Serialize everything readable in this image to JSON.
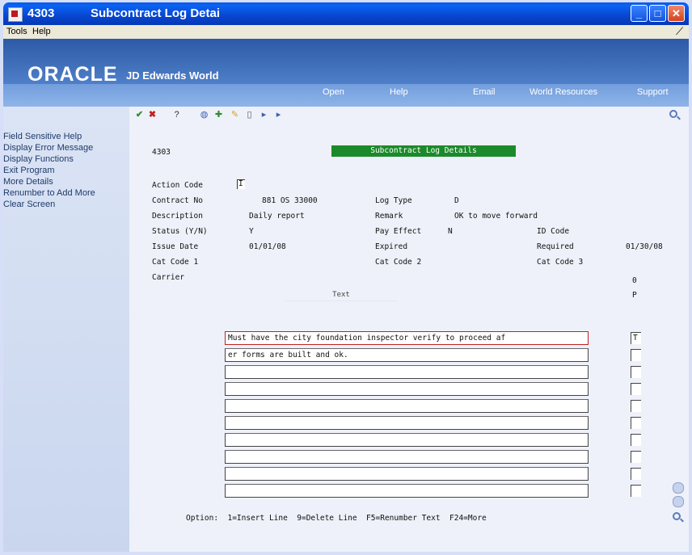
{
  "window": {
    "code": "4303",
    "title": "Subcontract Log Detai"
  },
  "menubar": {
    "tools": "Tools",
    "help": "Help"
  },
  "banner": {
    "logo": "ORACLE",
    "logo_sub": "JD Edwards World",
    "nav": [
      "Open",
      "Help",
      "Email",
      "World Resources",
      "Support"
    ]
  },
  "left_panel": {
    "items": [
      "Field Sensitive Help",
      "Display Error Message",
      "Display Functions",
      "Exit Program",
      "More Details",
      "Renumber to Add More",
      "Clear Screen"
    ]
  },
  "toolbar": {
    "help_glyph": "?"
  },
  "screen": {
    "program": "4303",
    "title": "Subcontract Log Details",
    "fields": {
      "action_code_label": "Action Code",
      "action_code_value": "I",
      "contract_no_label": "Contract No",
      "contract_no_value": "881 OS 33000",
      "log_type_label": "Log Type",
      "log_type_value": "D",
      "description_label": "Description",
      "description_value": "Daily report",
      "remark_label": "Remark",
      "remark_value": "OK to move forward",
      "status_label": "Status (Y/N)",
      "status_value": "Y",
      "pay_effect_label": "Pay Effect",
      "pay_effect_value": "N",
      "id_code_label": "ID Code",
      "issue_date_label": "Issue Date",
      "issue_date_value": "01/01/08",
      "expired_label": "Expired",
      "required_label": "Required",
      "required_value": "01/30/08",
      "cat_code_1_label": "Cat Code 1",
      "cat_code_2_label": "Cat Code 2",
      "cat_code_3_label": "Cat Code 3",
      "carrier_label": "Carrier"
    },
    "op_header_o": "0",
    "op_header_p": "P",
    "text_header": "Text",
    "text_lines": [
      "Must have the city foundation inspector verify to proceed af",
      "er forms are built and ok.",
      "",
      "",
      "",
      "",
      "",
      "",
      "",
      ""
    ],
    "option_values": [
      "T",
      "",
      "",
      "",
      "",
      "",
      "",
      "",
      "",
      ""
    ],
    "footer": "Option:  1=Insert Line  9=Delete Line  F5=Renumber Text  F24=More"
  }
}
